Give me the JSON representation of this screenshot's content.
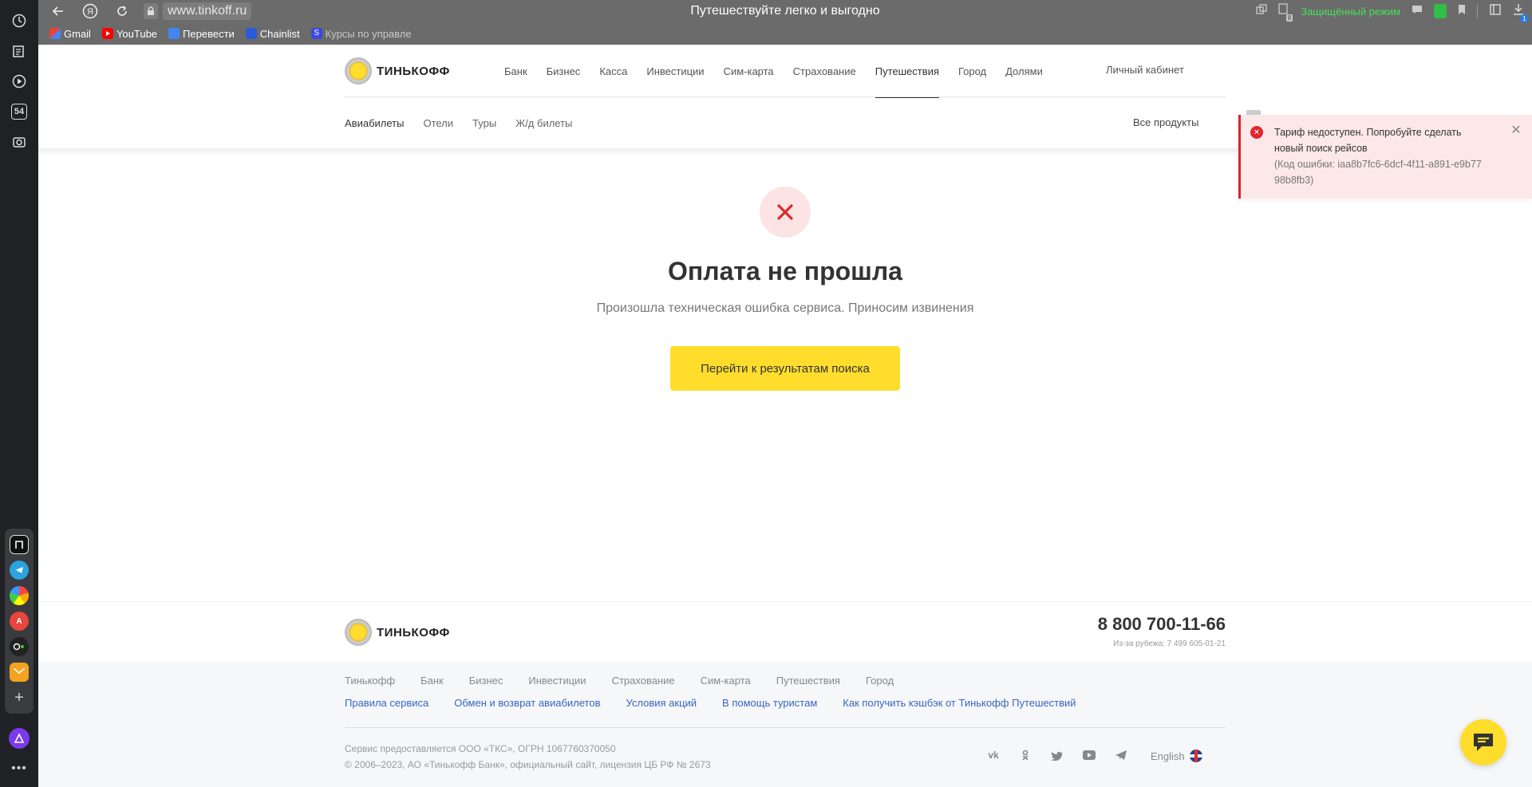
{
  "browser": {
    "url": "www.tinkoff.ru",
    "page_title": "Путешествуйте легко и выгодно",
    "secure_mode": "Защищённый режим",
    "bookmarks": [
      "Gmail",
      "YouTube",
      "Перевести",
      "Chainlist",
      "Курсы по управле"
    ],
    "sidebar_badge": "54",
    "download_badge": "1",
    "tab_badge": "8"
  },
  "site": {
    "brand": "ТИНЬКОФФ",
    "main_nav": [
      "Банк",
      "Бизнес",
      "Касса",
      "Инвестиции",
      "Сим-карта",
      "Страхование",
      "Путешествия",
      "Город",
      "Долями"
    ],
    "main_nav_active": "Путешествия",
    "cabinet": "Личный кабинет",
    "sub_nav": [
      "Авиабилеты",
      "Отели",
      "Туры",
      "Ж/д билеты"
    ],
    "all_products": "Все продукты"
  },
  "main": {
    "title": "Оплата не прошла",
    "subtitle": "Произошла техническая ошибка сервиса. Приносим извинения",
    "button": "Перейти к результатам поиска"
  },
  "toast": {
    "message": "Тариф недоступен. Попробуйте сделать новый поиск рейсов",
    "code": "(Код ошибки: iaa8b7fc6-6dcf-4f11-a891-e9b7798b8fb3)"
  },
  "footer": {
    "phone": "8 800 700-11-66",
    "phone_abroad": "Из-за рубежа: 7 499 605-01-21",
    "links_primary": [
      "Тинькофф",
      "Банк",
      "Бизнес",
      "Инвестиции",
      "Страхование",
      "Сим-карта",
      "Путешествия",
      "Город"
    ],
    "links_secondary": [
      "Правила сервиса",
      "Обмен и возврат авиабилетов",
      "Условия акций",
      "В помощь туристам",
      "Как получить кэшбэк от Тинькофф Путешествий"
    ],
    "legal_1": "Сервис предоставляется ООО «ТКС», ОГРН 1067760370050",
    "legal_2": "© 2006–2023, АО «Тинькофф Банк», официальный сайт, лицензия ЦБ РФ № 2673",
    "language": "English"
  },
  "colors": {
    "accent": "#ffdd2d",
    "error": "#d8262c",
    "link": "#3865c5"
  }
}
